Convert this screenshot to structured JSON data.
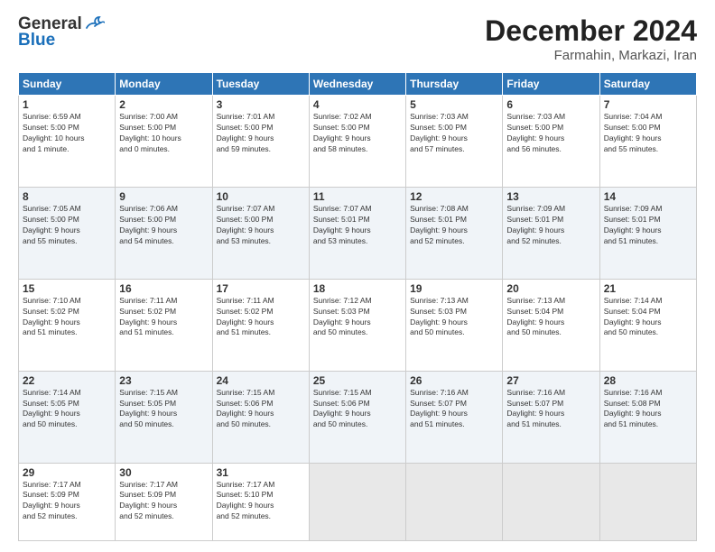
{
  "header": {
    "logo_line1": "General",
    "logo_line2": "Blue",
    "month_title": "December 2024",
    "location": "Farmahin, Markazi, Iran"
  },
  "weekdays": [
    "Sunday",
    "Monday",
    "Tuesday",
    "Wednesday",
    "Thursday",
    "Friday",
    "Saturday"
  ],
  "weeks": [
    [
      {
        "day": "1",
        "info": "Sunrise: 6:59 AM\nSunset: 5:00 PM\nDaylight: 10 hours\nand 1 minute."
      },
      {
        "day": "2",
        "info": "Sunrise: 7:00 AM\nSunset: 5:00 PM\nDaylight: 10 hours\nand 0 minutes."
      },
      {
        "day": "3",
        "info": "Sunrise: 7:01 AM\nSunset: 5:00 PM\nDaylight: 9 hours\nand 59 minutes."
      },
      {
        "day": "4",
        "info": "Sunrise: 7:02 AM\nSunset: 5:00 PM\nDaylight: 9 hours\nand 58 minutes."
      },
      {
        "day": "5",
        "info": "Sunrise: 7:03 AM\nSunset: 5:00 PM\nDaylight: 9 hours\nand 57 minutes."
      },
      {
        "day": "6",
        "info": "Sunrise: 7:03 AM\nSunset: 5:00 PM\nDaylight: 9 hours\nand 56 minutes."
      },
      {
        "day": "7",
        "info": "Sunrise: 7:04 AM\nSunset: 5:00 PM\nDaylight: 9 hours\nand 55 minutes."
      }
    ],
    [
      {
        "day": "8",
        "info": "Sunrise: 7:05 AM\nSunset: 5:00 PM\nDaylight: 9 hours\nand 55 minutes."
      },
      {
        "day": "9",
        "info": "Sunrise: 7:06 AM\nSunset: 5:00 PM\nDaylight: 9 hours\nand 54 minutes."
      },
      {
        "day": "10",
        "info": "Sunrise: 7:07 AM\nSunset: 5:00 PM\nDaylight: 9 hours\nand 53 minutes."
      },
      {
        "day": "11",
        "info": "Sunrise: 7:07 AM\nSunset: 5:01 PM\nDaylight: 9 hours\nand 53 minutes."
      },
      {
        "day": "12",
        "info": "Sunrise: 7:08 AM\nSunset: 5:01 PM\nDaylight: 9 hours\nand 52 minutes."
      },
      {
        "day": "13",
        "info": "Sunrise: 7:09 AM\nSunset: 5:01 PM\nDaylight: 9 hours\nand 52 minutes."
      },
      {
        "day": "14",
        "info": "Sunrise: 7:09 AM\nSunset: 5:01 PM\nDaylight: 9 hours\nand 51 minutes."
      }
    ],
    [
      {
        "day": "15",
        "info": "Sunrise: 7:10 AM\nSunset: 5:02 PM\nDaylight: 9 hours\nand 51 minutes."
      },
      {
        "day": "16",
        "info": "Sunrise: 7:11 AM\nSunset: 5:02 PM\nDaylight: 9 hours\nand 51 minutes."
      },
      {
        "day": "17",
        "info": "Sunrise: 7:11 AM\nSunset: 5:02 PM\nDaylight: 9 hours\nand 51 minutes."
      },
      {
        "day": "18",
        "info": "Sunrise: 7:12 AM\nSunset: 5:03 PM\nDaylight: 9 hours\nand 50 minutes."
      },
      {
        "day": "19",
        "info": "Sunrise: 7:13 AM\nSunset: 5:03 PM\nDaylight: 9 hours\nand 50 minutes."
      },
      {
        "day": "20",
        "info": "Sunrise: 7:13 AM\nSunset: 5:04 PM\nDaylight: 9 hours\nand 50 minutes."
      },
      {
        "day": "21",
        "info": "Sunrise: 7:14 AM\nSunset: 5:04 PM\nDaylight: 9 hours\nand 50 minutes."
      }
    ],
    [
      {
        "day": "22",
        "info": "Sunrise: 7:14 AM\nSunset: 5:05 PM\nDaylight: 9 hours\nand 50 minutes."
      },
      {
        "day": "23",
        "info": "Sunrise: 7:15 AM\nSunset: 5:05 PM\nDaylight: 9 hours\nand 50 minutes."
      },
      {
        "day": "24",
        "info": "Sunrise: 7:15 AM\nSunset: 5:06 PM\nDaylight: 9 hours\nand 50 minutes."
      },
      {
        "day": "25",
        "info": "Sunrise: 7:15 AM\nSunset: 5:06 PM\nDaylight: 9 hours\nand 50 minutes."
      },
      {
        "day": "26",
        "info": "Sunrise: 7:16 AM\nSunset: 5:07 PM\nDaylight: 9 hours\nand 51 minutes."
      },
      {
        "day": "27",
        "info": "Sunrise: 7:16 AM\nSunset: 5:07 PM\nDaylight: 9 hours\nand 51 minutes."
      },
      {
        "day": "28",
        "info": "Sunrise: 7:16 AM\nSunset: 5:08 PM\nDaylight: 9 hours\nand 51 minutes."
      }
    ],
    [
      {
        "day": "29",
        "info": "Sunrise: 7:17 AM\nSunset: 5:09 PM\nDaylight: 9 hours\nand 52 minutes."
      },
      {
        "day": "30",
        "info": "Sunrise: 7:17 AM\nSunset: 5:09 PM\nDaylight: 9 hours\nand 52 minutes."
      },
      {
        "day": "31",
        "info": "Sunrise: 7:17 AM\nSunset: 5:10 PM\nDaylight: 9 hours\nand 52 minutes."
      },
      {
        "day": "",
        "info": ""
      },
      {
        "day": "",
        "info": ""
      },
      {
        "day": "",
        "info": ""
      },
      {
        "day": "",
        "info": ""
      }
    ]
  ]
}
